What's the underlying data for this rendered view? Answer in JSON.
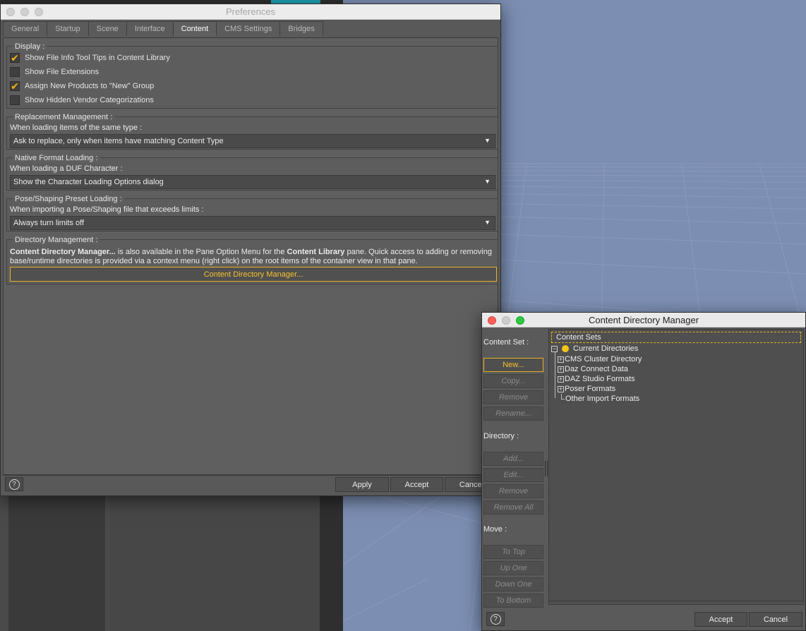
{
  "preferences": {
    "title": "Preferences",
    "tabs": [
      {
        "label": "General"
      },
      {
        "label": "Startup"
      },
      {
        "label": "Scene"
      },
      {
        "label": "Interface"
      },
      {
        "label": "Content",
        "active": true
      },
      {
        "label": "CMS Settings"
      },
      {
        "label": "Bridges"
      }
    ],
    "display": {
      "title": "Display :",
      "options": [
        {
          "label": "Show File Info Tool Tips in Content Library",
          "checked": true
        },
        {
          "label": "Show File Extensions",
          "checked": false
        },
        {
          "label": "Assign New Products to \"New\" Group",
          "checked": true
        },
        {
          "label": "Show Hidden Vendor Categorizations",
          "checked": false
        }
      ]
    },
    "replacement": {
      "title": "Replacement Management :",
      "prompt": "When loading items of the same type :",
      "value": "Ask to replace, only when items have matching Content Type"
    },
    "native": {
      "title": "Native Format Loading :",
      "prompt": "When loading a DUF Character :",
      "value": "Show the Character Loading Options dialog"
    },
    "pose": {
      "title": "Pose/Shaping Preset Loading :",
      "prompt": "When importing a Pose/Shaping file that exceeds limits :",
      "value": "Always turn limits off"
    },
    "directory": {
      "title": "Directory Management :",
      "desc_bold1": "Content Directory Manager...",
      "desc_text1": " is also available in the Pane Option Menu for the ",
      "desc_bold2": "Content Library",
      "desc_text2": " pane. Quick access to adding or removing base/runtime directories is provided via a context menu (right click) on the root items of the container view in that pane.",
      "button": "Content Directory Manager..."
    },
    "footer": {
      "help": "?",
      "apply": "Apply",
      "accept": "Accept",
      "cancel": "Cancel"
    }
  },
  "cdm": {
    "title": "Content Directory Manager",
    "content_set_label": "Content Set :",
    "content_set_buttons": [
      {
        "label": "New...",
        "enabled": true
      },
      {
        "label": "Copy...",
        "enabled": false
      },
      {
        "label": "Remove",
        "enabled": false
      },
      {
        "label": "Rename...",
        "enabled": false
      }
    ],
    "directory_label": "Directory :",
    "directory_buttons": [
      {
        "label": "Add...",
        "enabled": false
      },
      {
        "label": "Edit...",
        "enabled": false
      },
      {
        "label": "Remove",
        "enabled": false
      },
      {
        "label": "Remove All",
        "enabled": false
      }
    ],
    "move_label": "Move :",
    "move_buttons": [
      {
        "label": "To Top",
        "enabled": false
      },
      {
        "label": "Up One",
        "enabled": false
      },
      {
        "label": "Down One",
        "enabled": false
      },
      {
        "label": "To Bottom",
        "enabled": false
      }
    ],
    "tree": {
      "header": "Content Sets",
      "root": {
        "label": "Current Directories",
        "expanded": true
      },
      "children": [
        {
          "label": "CMS Cluster Directory",
          "expandable": true
        },
        {
          "label": "Daz Connect Data",
          "expandable": true
        },
        {
          "label": "DAZ Studio Formats",
          "expandable": true
        },
        {
          "label": "Poser Formats",
          "expandable": true
        },
        {
          "label": "Other Import Formats",
          "expandable": false
        }
      ]
    },
    "footer": {
      "help": "?",
      "accept": "Accept",
      "cancel": "Cancel"
    }
  }
}
